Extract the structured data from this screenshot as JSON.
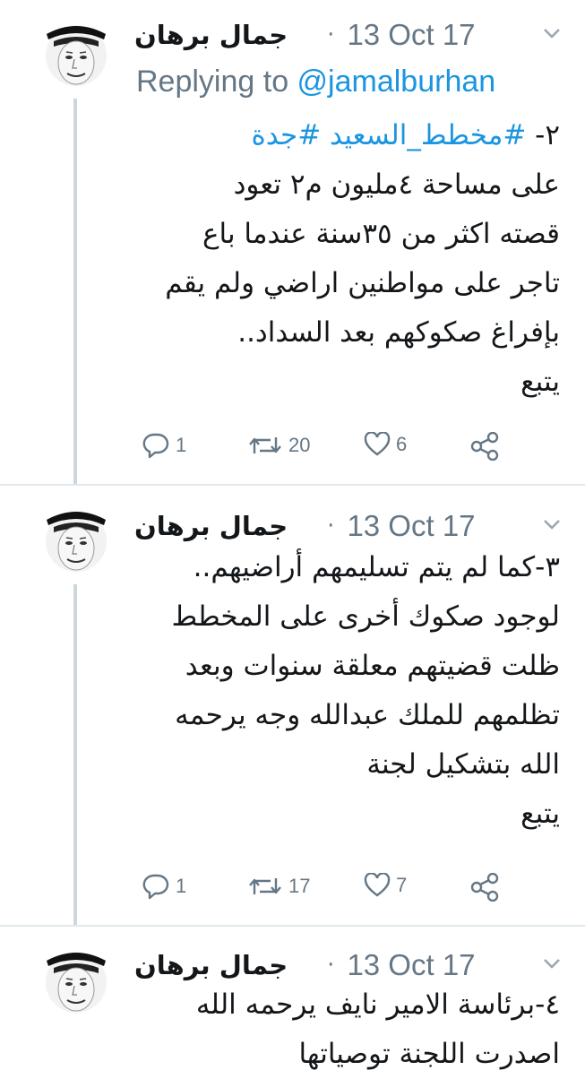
{
  "tweets": [
    {
      "author": "جمال برهان",
      "separator": "·",
      "date": "13 Oct 17",
      "replying_prefix": "Replying to ",
      "replying_handle": "@jamalburhan",
      "lines": [
        {
          "prefix": "٢-",
          "hashtags": "#مخطط_السعيد #جدة"
        },
        "على مساحة ٤مليون م٢ تعود",
        "قصته اكثر من ٣٥سنة عندما باع",
        "تاجر على مواطنين اراضي ولم يقم",
        "بإفراغ صكوكهم بعد السداد..",
        "يتبع"
      ],
      "replies": "1",
      "retweets": "20",
      "likes": "6"
    },
    {
      "author": "جمال برهان",
      "separator": "·",
      "date": "13 Oct 17",
      "lines": [
        "٣-كما لم يتم تسليمهم أراضيهم..",
        "لوجود صكوك أخرى على المخطط",
        "ظلت قضيتهم معلقة سنوات وبعد",
        "تظلمهم للملك عبدالله وجه يرحمه",
        "الله بتشكيل لجنة",
        "يتبع"
      ],
      "replies": "1",
      "retweets": "17",
      "likes": "7"
    },
    {
      "author": "جمال برهان",
      "separator": "·",
      "date": "13 Oct 17",
      "lines": [
        "٤-برئاسة الامير نايف يرحمه الله",
        "اصدرت اللجنة توصياتها"
      ]
    }
  ],
  "icons": {
    "reply": "reply-icon",
    "retweet": "retweet-icon",
    "like": "heart-icon",
    "share": "share-icon",
    "more": "chevron-down-icon"
  },
  "colors": {
    "text": "#14171a",
    "muted": "#657786",
    "link": "#1b95e0",
    "thread": "#ccd6dd"
  }
}
